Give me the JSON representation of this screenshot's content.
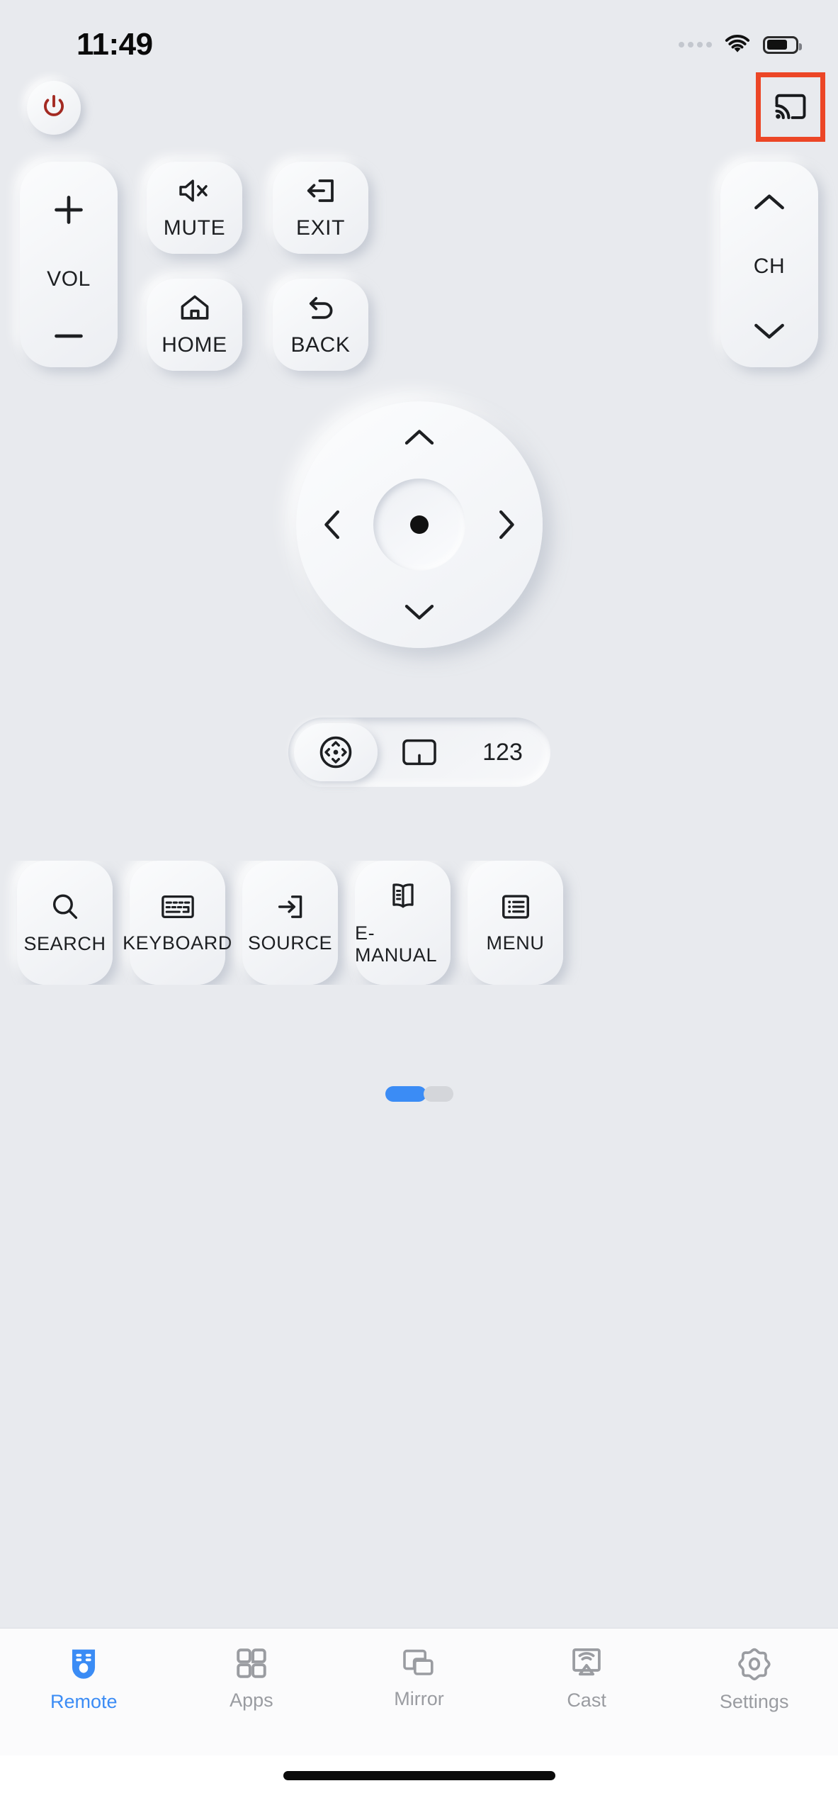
{
  "status_bar": {
    "time": "11:49",
    "wifi_icon": "wifi-icon",
    "battery_icon": "battery-icon",
    "signal_dots_icon": "signal-dots-icon"
  },
  "header": {
    "power_button": {
      "icon": "power-icon",
      "color": "#a32a22"
    },
    "cast_button": {
      "icon": "cast-icon",
      "highlight_color": "#ec4626"
    }
  },
  "controls": {
    "volume": {
      "label": "VOL",
      "up_icon": "plus-icon",
      "down_icon": "minus-icon"
    },
    "channel": {
      "label": "CH",
      "up_icon": "chevron-up-icon",
      "down_icon": "chevron-down-icon"
    },
    "keys": [
      {
        "label": "MUTE",
        "icon": "speaker-mute-icon"
      },
      {
        "label": "EXIT",
        "icon": "exit-arrow-icon"
      },
      {
        "label": "HOME",
        "icon": "home-icon"
      },
      {
        "label": "BACK",
        "icon": "back-arrow-icon"
      }
    ]
  },
  "dpad": {
    "up_icon": "chevron-up-icon",
    "down_icon": "chevron-down-icon",
    "left_icon": "chevron-left-icon",
    "right_icon": "chevron-right-icon",
    "ok_icon": "ok-dot-icon"
  },
  "mode_pill": {
    "segments": [
      {
        "name": "dpad",
        "icon": "dpad-circle-icon",
        "label": "",
        "active": true
      },
      {
        "name": "touchpad",
        "icon": "touchpad-icon",
        "label": "",
        "active": false
      },
      {
        "name": "numbers",
        "icon": "",
        "label": "123",
        "active": false
      }
    ]
  },
  "function_row": {
    "items": [
      {
        "label": "SEARCH",
        "icon": "search-icon"
      },
      {
        "label": "KEYBOARD",
        "icon": "keyboard-icon"
      },
      {
        "label": "SOURCE",
        "icon": "source-input-icon"
      },
      {
        "label": "E-MANUAL",
        "icon": "book-icon"
      },
      {
        "label": "MENU",
        "icon": "list-menu-icon"
      }
    ]
  },
  "pagination": {
    "current_page": 1,
    "total_pages": 2
  },
  "tab_bar": {
    "active_color": "#3b8cf5",
    "inactive_color": "#9a9ca1",
    "tabs": [
      {
        "label": "Remote",
        "icon": "remote-icon",
        "active": true
      },
      {
        "label": "Apps",
        "icon": "grid-apps-icon",
        "active": false
      },
      {
        "label": "Mirror",
        "icon": "screen-mirror-icon",
        "active": false
      },
      {
        "label": "Cast",
        "icon": "cast-screen-icon",
        "active": false
      },
      {
        "label": "Settings",
        "icon": "gear-icon",
        "active": false
      }
    ]
  }
}
